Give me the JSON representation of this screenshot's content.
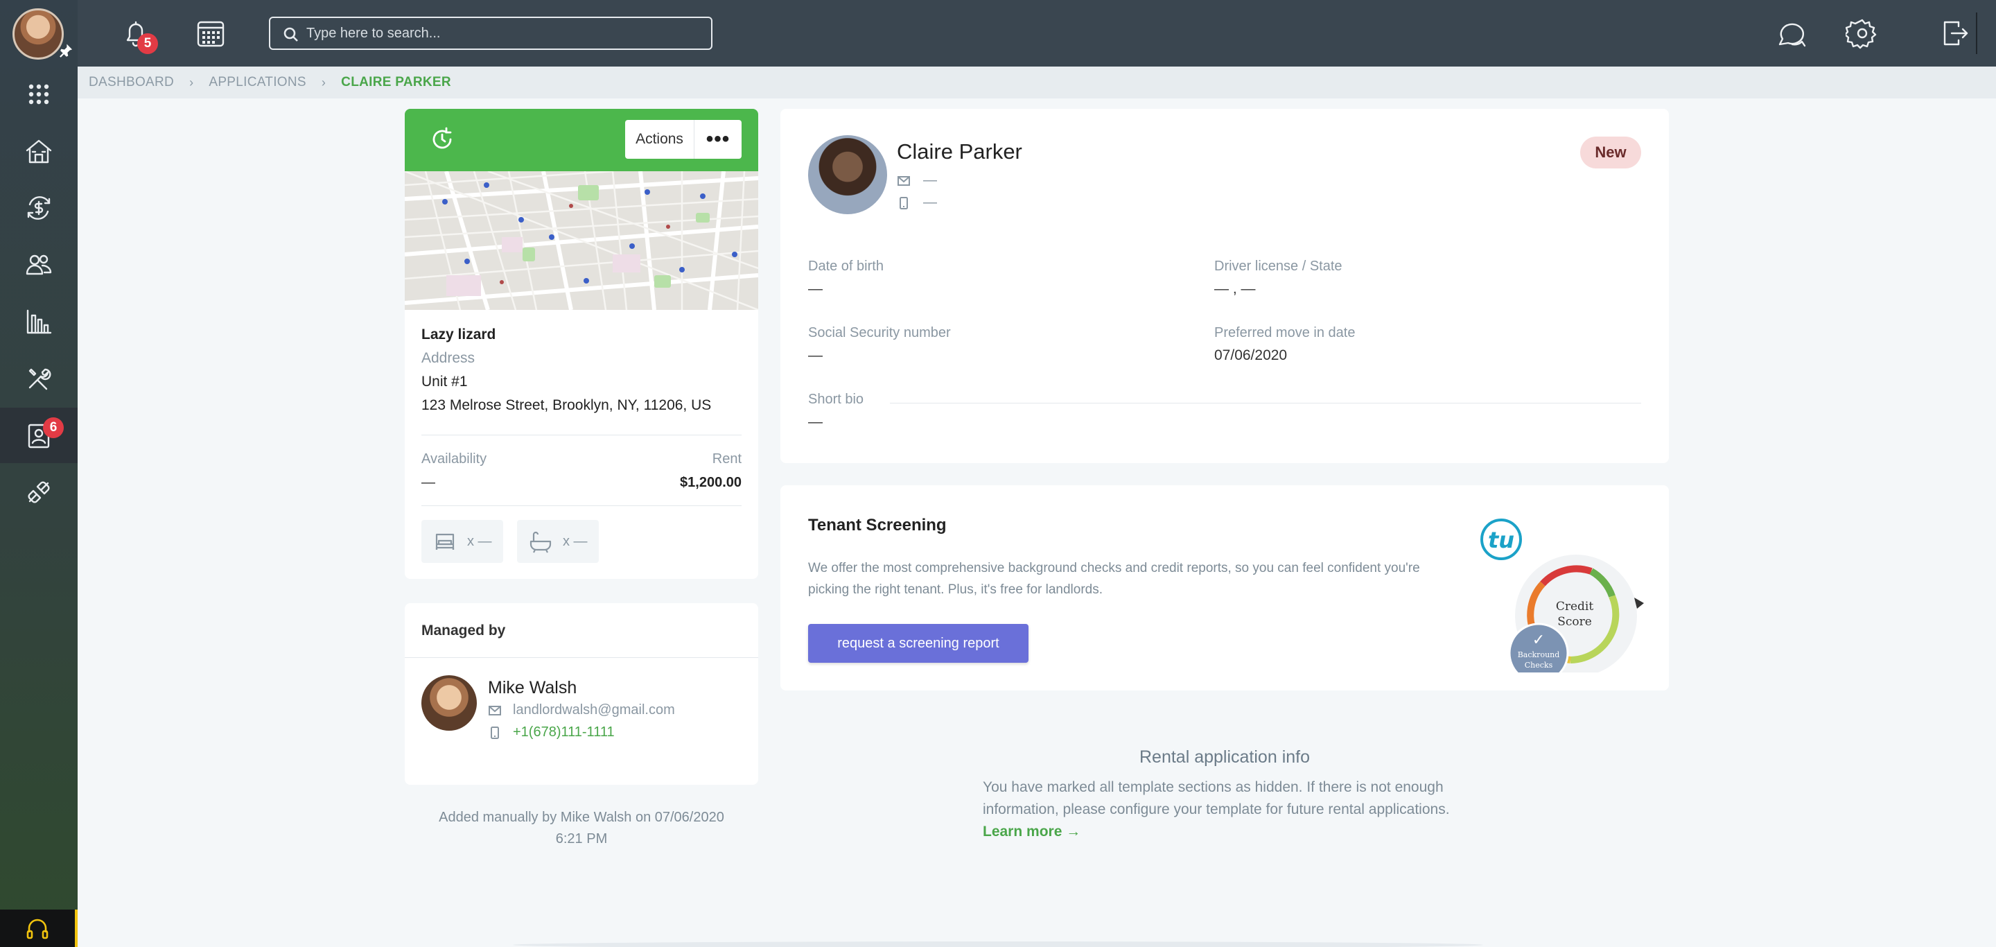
{
  "topbar": {
    "notification_count": "5",
    "search_placeholder": "Type here to search..."
  },
  "sidebar": {
    "items": [
      {
        "name": "apps-grid-icon"
      },
      {
        "name": "properties-icon"
      },
      {
        "name": "accounting-icon"
      },
      {
        "name": "people-icon"
      },
      {
        "name": "reports-icon"
      },
      {
        "name": "maintenance-icon"
      },
      {
        "name": "applications-icon",
        "badge": "6",
        "active": true
      },
      {
        "name": "integrations-icon"
      }
    ]
  },
  "breadcrumb": {
    "items": [
      "DASHBOARD",
      "APPLICATIONS"
    ],
    "current": "CLAIRE PARKER"
  },
  "property": {
    "actions_label": "Actions",
    "more_label": "•••",
    "name": "Lazy lizard",
    "address_label": "Address",
    "unit": "Unit #1",
    "address": "123 Melrose Street, Brooklyn, NY, 11206, US",
    "availability_label": "Availability",
    "availability_value": "—",
    "rent_label": "Rent",
    "rent_value": "$1,200.00",
    "beds": "x —",
    "baths": "x —"
  },
  "managed_by": {
    "title": "Managed by",
    "name": "Mike Walsh",
    "email": "landlordwalsh@gmail.com",
    "phone": "+1(678)111-1111"
  },
  "added_note": {
    "line1": "Added manually by Mike Walsh on 07/06/2020",
    "line2": "6:21 PM"
  },
  "applicant": {
    "name": "Claire Parker",
    "email": "—",
    "phone": "—",
    "status": "New",
    "fields": {
      "dob_label": "Date of birth",
      "dob_value": "—",
      "license_label": "Driver license / State",
      "license_value": "— , —",
      "ssn_label": "Social Security number",
      "ssn_value": "—",
      "move_in_label": "Preferred move in date",
      "move_in_value": "07/06/2020",
      "bio_label": "Short bio",
      "bio_value": "—"
    }
  },
  "screening": {
    "title": "Tenant Screening",
    "description": "We offer the most comprehensive background checks and credit reports, so you can feel confident you're picking the right tenant. Plus, it's free for landlords.",
    "button_label": "request a screening report",
    "logo_text": "tu",
    "credit_score_line1": "Credit",
    "credit_score_line2": "Score",
    "checkmark": "✓",
    "background_line1": "Backround",
    "background_line2": "Checks"
  },
  "rental_info": {
    "title": "Rental application info",
    "text": "You have marked all template sections as hidden. If there is not enough information, please configure your template for future rental applications.",
    "link": "Learn more →"
  },
  "colors": {
    "green": "#4cb74c",
    "topbar": "#3a4650",
    "badge_red": "#e23b45",
    "button_purple": "#6a70d9"
  }
}
